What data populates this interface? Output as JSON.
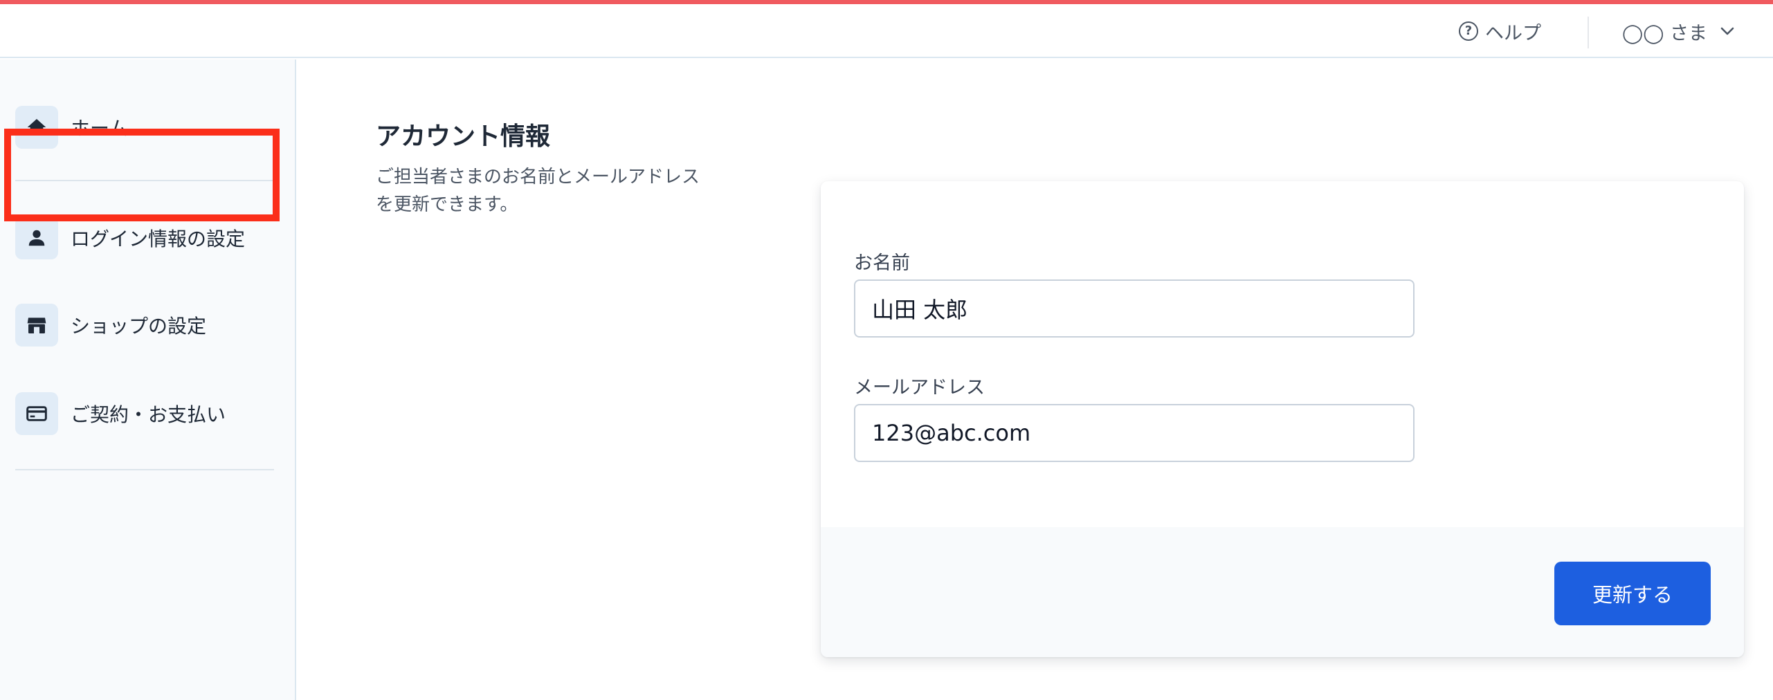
{
  "header": {
    "help_label": "ヘルプ",
    "user_label": "◯◯ さま"
  },
  "sidebar": {
    "items": [
      {
        "label": "ホーム",
        "icon": "home-icon"
      },
      {
        "label": "ログイン情報の設定",
        "icon": "user-icon"
      },
      {
        "label": "ショップの設定",
        "icon": "store-icon"
      },
      {
        "label": "ご契約・お支払い",
        "icon": "credit-card-icon"
      }
    ],
    "highlighted_item": "ログイン情報の設定"
  },
  "main": {
    "title": "アカウント情報",
    "description": "ご担当者さまのお名前とメールアドレスを更新できます。",
    "form": {
      "name_label": "お名前",
      "name_value": "山田 太郎",
      "email_label": "メールアドレス",
      "email_value": "123@abc.com",
      "submit_label": "更新する"
    }
  },
  "colors": {
    "accent_bar": "#f05a5f",
    "primary_button": "#1d5fe0",
    "highlight_box": "#fb2e1a",
    "icon_bg": "#e1ecf7"
  }
}
